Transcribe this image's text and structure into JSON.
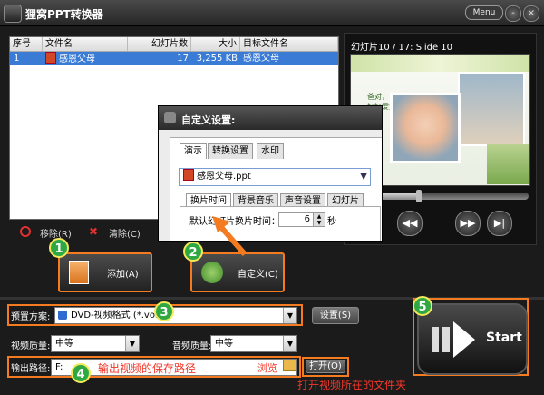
{
  "app": {
    "title": "狸窝PPT转换器",
    "menu_label": "Menu",
    "minimize": "-",
    "close": "×"
  },
  "table": {
    "headers": [
      "序号",
      "文件名",
      "幻灯片数",
      "大小",
      "目标文件名"
    ],
    "rows": [
      {
        "index": "1",
        "filename": "感恩父母",
        "slides": "17",
        "size": "3,255 KB",
        "target": "感恩父母"
      }
    ]
  },
  "file_actions": {
    "remove": "移除(R)",
    "clear": "清除(C)"
  },
  "preview": {
    "slide_label": "幻灯片10 / 17: Slide 10",
    "slide_text": [
      "爸对，  他们会的",
      "好好爱父",
      "母。"
    ],
    "progress_fraction": 0.38
  },
  "main_buttons": {
    "add": "添加(A)",
    "customize": "自定义(C)"
  },
  "dialog": {
    "title": "自定义设置:",
    "tabs": [
      "演示",
      "转换设置",
      "水印"
    ],
    "file_value": "感恩父母.ppt",
    "subtabs": [
      "换片时间",
      "背景音乐",
      "声音设置",
      "幻灯片"
    ],
    "interval_label": "默认幻灯片换片时间：",
    "interval_value": "6",
    "interval_unit": "秒"
  },
  "settings": {
    "preset_label": "预置方案:",
    "preset_value": "DVD-视频格式 (*.vob)",
    "settings_button": "设置(S)",
    "video_quality_label": "视频质量:",
    "video_quality_value": "中等",
    "audio_quality_label": "音频质量:",
    "audio_quality_value": "中等",
    "output_label": "输出路径:",
    "output_value": "F:",
    "browse_label": "浏览",
    "open_button": "打开(O)",
    "start_label": "Start"
  },
  "annotations": {
    "n1": "1",
    "n2": "2",
    "n3": "3",
    "n4": "4",
    "n5": "5",
    "output_hint": "输出视频的保存路径",
    "open_hint": "打开视频所在的文件夹"
  },
  "colors": {
    "highlight": "#f47b20",
    "annotation_text": "#f1372a",
    "badge": "#2fa844",
    "selection": "#3a7bd5"
  }
}
